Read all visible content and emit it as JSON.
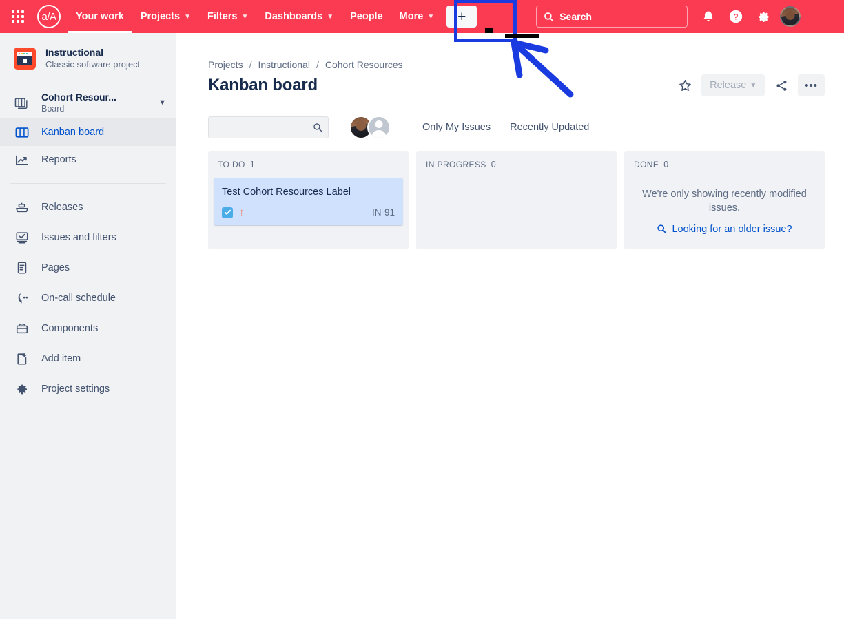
{
  "topnav": {
    "app_switcher": "apps-grid-icon",
    "logo_text": "a/A",
    "items": [
      {
        "label": "Your work",
        "has_chevron": false
      },
      {
        "label": "Projects",
        "has_chevron": true
      },
      {
        "label": "Filters",
        "has_chevron": true
      },
      {
        "label": "Dashboards",
        "has_chevron": true
      },
      {
        "label": "People",
        "has_chevron": false
      },
      {
        "label": "More",
        "has_chevron": true
      }
    ],
    "create_label": "+",
    "search_placeholder": "Search",
    "search_value": "",
    "icons": [
      "notifications-bell-icon",
      "help-icon",
      "settings-gear-icon",
      "profile-avatar"
    ],
    "background_color": "#fb3b52"
  },
  "sidebar": {
    "project": {
      "name": "Instructional",
      "subtitle": "Classic software project",
      "icon": "project-window-icon"
    },
    "board_group": {
      "name": "Cohort Resour...",
      "subtitle": "Board",
      "icon": "board-stack-icon",
      "chevron": "chevron-down-icon"
    },
    "primary_items": [
      {
        "label": "Kanban board",
        "icon": "board-columns-icon",
        "selected": true
      },
      {
        "label": "Reports",
        "icon": "reports-chart-icon",
        "selected": false
      }
    ],
    "secondary_items": [
      {
        "label": "Releases",
        "icon": "releases-ship-icon"
      },
      {
        "label": "Issues and filters",
        "icon": "issues-filters-icon"
      },
      {
        "label": "Pages",
        "icon": "pages-document-icon"
      },
      {
        "label": "On-call schedule",
        "icon": "on-call-phone-icon"
      },
      {
        "label": "Components",
        "icon": "components-box-icon"
      },
      {
        "label": "Add item",
        "icon": "add-item-icon"
      },
      {
        "label": "Project settings",
        "icon": "settings-gear-icon"
      }
    ]
  },
  "header": {
    "breadcrumb": [
      {
        "label": "Projects"
      },
      {
        "label": "Instructional"
      },
      {
        "label": "Cohort Resources"
      }
    ],
    "breadcrumb_separator": "/",
    "title": "Kanban board",
    "actions": {
      "star_icon": "star-icon",
      "release_label": "Release",
      "release_chevron": "chevron-down-icon",
      "share_icon": "share-icon",
      "more_label": "•••"
    }
  },
  "toolbar": {
    "search_value": "",
    "search_placeholder": "",
    "search_icon": "search-icon",
    "avatars": [
      "user-avatar-photo",
      "user-avatar-default"
    ],
    "filters": [
      {
        "label": "Only My Issues"
      },
      {
        "label": "Recently Updated"
      }
    ]
  },
  "board": {
    "columns": [
      {
        "name": "TO DO",
        "count": "1",
        "cards": [
          {
            "title": "Test Cohort Resources Label",
            "key": "IN-91",
            "type_icon": "task-checkbox-icon",
            "priority_icon": "priority-high-arrow-icon",
            "selected": true
          }
        ],
        "empty_message": "",
        "empty_link": ""
      },
      {
        "name": "IN PROGRESS",
        "count": "0",
        "cards": [],
        "empty_message": "",
        "empty_link": ""
      },
      {
        "name": "DONE",
        "count": "0",
        "cards": [],
        "empty_message": "We're only showing recently modified issues.",
        "empty_link": "Looking for an older issue?",
        "empty_link_icon": "search-icon"
      }
    ]
  },
  "annotation": {
    "highlight_target": "create-button",
    "box_color": "#1a3be0",
    "arrow": "pointer-arrow-up-left",
    "cursor_marks": [
      "cursor-dot",
      "cursor-bar"
    ]
  },
  "colors": {
    "nav_red": "#fb3b52",
    "link_blue": "#0052cc",
    "text_dark": "#172b4d",
    "text_muted": "#5e6c84",
    "column_bg": "#f1f2f5",
    "card_selected": "#cfe1fd",
    "priority_orange": "#ff7452",
    "task_blue": "#4bade8",
    "annotation_blue": "#1a3be0"
  }
}
